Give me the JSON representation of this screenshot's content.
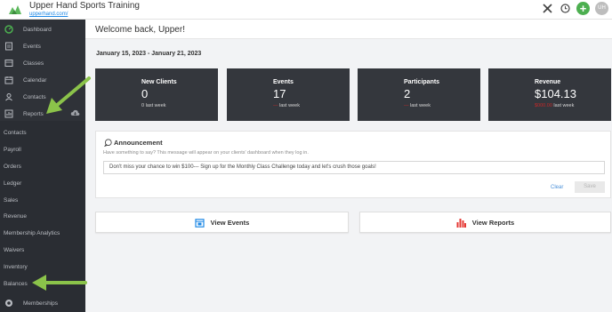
{
  "app": {
    "name": "Upper Hand Sports Training",
    "url": "upperhand.com/",
    "avatar_initials": "UH",
    "plus": "+",
    "colors": {
      "accent_green": "#4caf50",
      "sidebar_bg": "#2a2d33",
      "card_bg": "#34373d",
      "alert_red": "#c62828",
      "link_blue": "#4a90d9",
      "arrow_green": "#8bc34a"
    }
  },
  "top_icons": [
    "tools-icon",
    "clock-icon",
    "plus-icon",
    "avatar"
  ],
  "sidebar": {
    "primary": [
      {
        "label": "Dashboard",
        "icon": "dashboard-icon"
      },
      {
        "label": "Events",
        "icon": "events-icon"
      },
      {
        "label": "Classes",
        "icon": "classes-icon"
      },
      {
        "label": "Calendar",
        "icon": "calendar-icon"
      },
      {
        "label": "Contacts",
        "icon": "contacts-icon"
      },
      {
        "label": "Reports",
        "icon": "reports-icon"
      }
    ],
    "reports_sub": [
      "Contacts",
      "Payroll",
      "Orders",
      "Ledger",
      "Sales",
      "Revenue",
      "Membership Analytics",
      "Waivers",
      "Inventory",
      "Balances"
    ],
    "bottom": {
      "label": "Memberships",
      "icon": "memberships-icon"
    }
  },
  "main": {
    "welcome": "Welcome back, Upper!",
    "date_range": "January 15, 2023 - January 21, 2023",
    "stats": [
      {
        "label": "New Clients",
        "value": "0",
        "change": "0",
        "suffix": "last week",
        "negative": false
      },
      {
        "label": "Events",
        "value": "17",
        "change": "—",
        "suffix": "last week",
        "negative": true
      },
      {
        "label": "Participants",
        "value": "2",
        "change": "—",
        "suffix": "last week",
        "negative": true
      },
      {
        "label": "Revenue",
        "value": "$104.13",
        "change": "$000.00",
        "suffix": "last week",
        "negative": true
      }
    ],
    "announcement": {
      "title": "Announcement",
      "description": "Have something to say? This message will appear on your clients' dashboard when they log in.",
      "message": "Don't miss your chance to win $100--- Sign up for the Monthly Class Challenge today and let's crush those goals!",
      "clear_label": "Clear",
      "save_label": "Save"
    },
    "view_events_label": "View Events",
    "view_reports_label": "View Reports"
  }
}
